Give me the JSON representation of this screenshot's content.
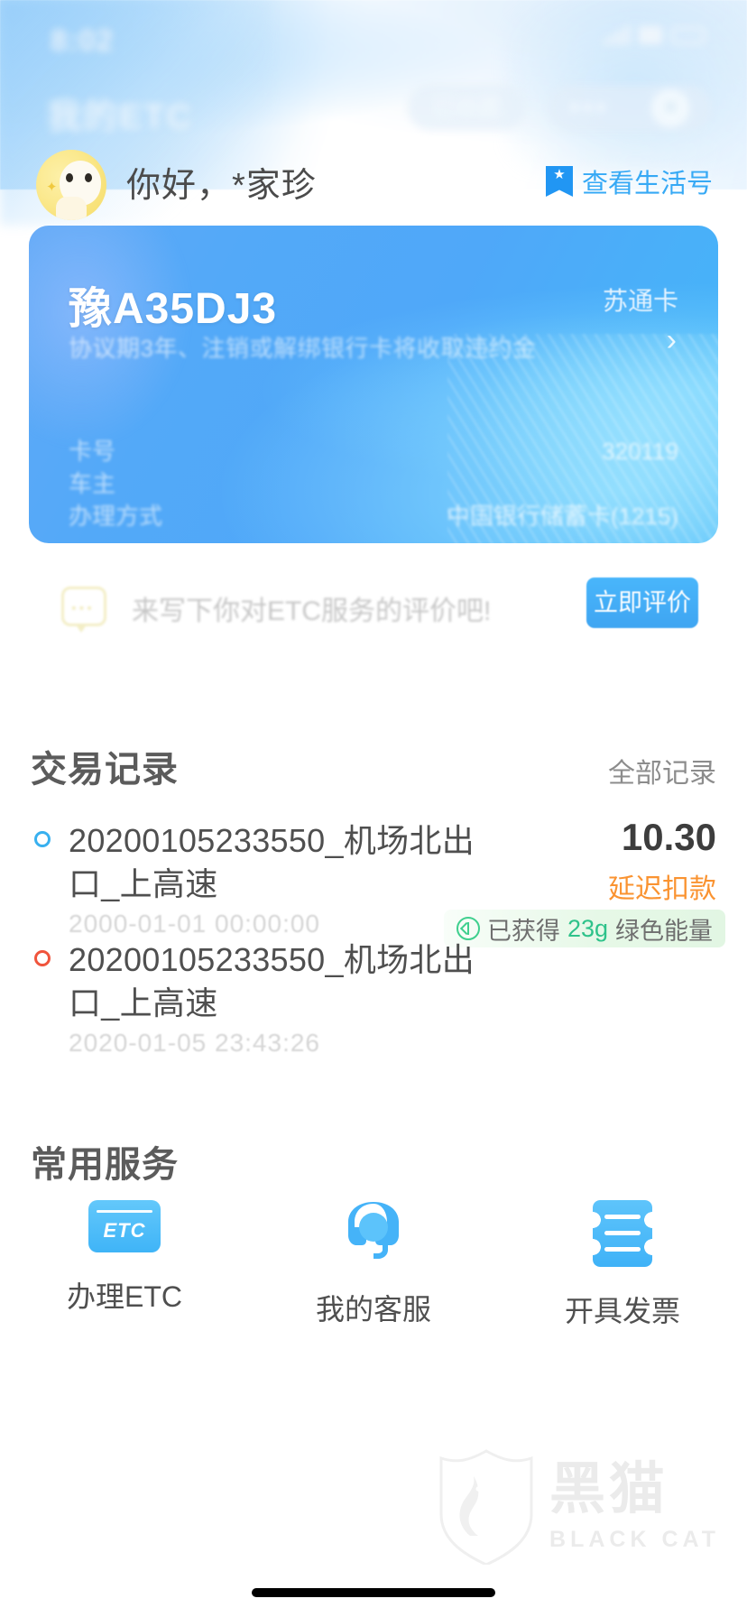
{
  "statusbar": {
    "time": "8:02",
    "signal_icon": "signal-bars-icon",
    "wifi_icon": "wifi-icon",
    "battery_icon": "battery-icon"
  },
  "navbar": {
    "title": "我的ETC",
    "favorite_label": "已收藏",
    "more_icon": "more-dots-icon",
    "close_icon": "close-icon"
  },
  "greeting": {
    "avatar_icon": "user-avatar-icon",
    "text": "你好，*家珍",
    "life_link_label": "查看生活号",
    "life_link_icon": "bookmark-star-icon",
    "accent": "#36a9f5"
  },
  "etc_card": {
    "plate": "豫A35DJ3",
    "card_type": "苏通卡",
    "note": "协议期3年、注销或解绑银行卡将收取违约金",
    "arrow_icon": "chevron-right-icon",
    "rows": [
      {
        "label": "卡号",
        "value": "320119"
      },
      {
        "label": "车主",
        "value": ""
      },
      {
        "label": "办理方式",
        "value": "中国银行储蓄卡(1215)"
      }
    ],
    "bg_color": "#4fa8f9"
  },
  "evaluate": {
    "icon": "comment-bubble-icon",
    "text": "来写下你对ETC服务的评价吧!",
    "button_label": "立即评价",
    "button_color": "#44aef7"
  },
  "transactions": {
    "title": "交易记录",
    "more_label": "全部记录",
    "items": [
      {
        "marker": "blue",
        "title": "20200105233550_机场北出口_上高速",
        "date": "2000-01-01 00:00:00",
        "amount": "10.30",
        "status": "延迟扣款",
        "status_color": "#fa9331",
        "energy_prefix": "已获得",
        "energy_value": "23g",
        "energy_suffix": "绿色能量",
        "energy_icon": "leaf-energy-icon"
      },
      {
        "marker": "red",
        "title": "20200105233550_机场北出口_上高速",
        "date": "2020-01-05 23:43:26",
        "amount": "",
        "status": "",
        "status_color": "",
        "energy_prefix": "",
        "energy_value": "",
        "energy_suffix": "",
        "energy_icon": ""
      }
    ]
  },
  "services": {
    "title": "常用服务",
    "items": [
      {
        "label": "办理ETC",
        "icon": "etc-card-icon"
      },
      {
        "label": "我的客服",
        "icon": "headset-support-icon"
      },
      {
        "label": "开具发票",
        "icon": "invoice-ticket-icon"
      }
    ]
  },
  "watermark": {
    "cn": "黑猫",
    "en": "BLACK CAT",
    "icon": "black-cat-shield-icon"
  }
}
